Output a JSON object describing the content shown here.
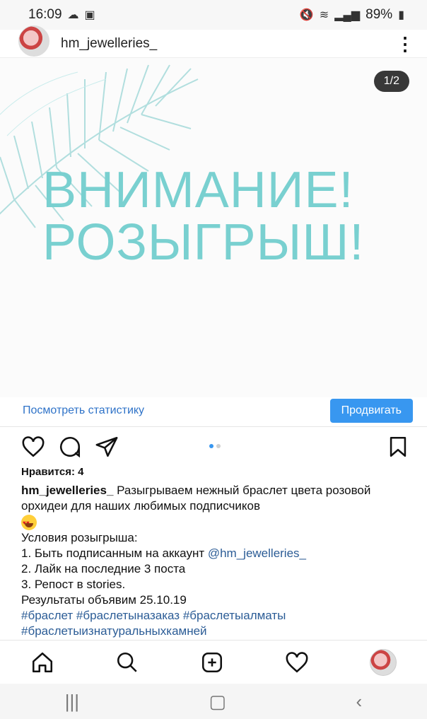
{
  "status": {
    "time": "16:09",
    "battery": "89%"
  },
  "post": {
    "username": "hm_jewelleries_",
    "counter": "1/2",
    "headline_line1": "ВНИМАНИЕ!",
    "headline_line2": "РОЗЫГРЫШ!"
  },
  "promo": {
    "stats_link": "Посмотреть статистику",
    "promote_button": "Продвигать"
  },
  "engagement": {
    "likes": "Нравится: 4"
  },
  "caption": {
    "username": "hm_jewelleries_",
    "line1": "Разыгрываем нежный браслет цвета розовой орхидеи для наших любимых подписчиков",
    "conditions_title": "Условия розыгрыша:",
    "condition1_text": "1. Быть подписанным на аккаунт ",
    "condition1_link": "@hm_jewelleries_",
    "condition2": "2. Лайк на последние 3 поста",
    "condition3": "3. Репост в stories.",
    "results": "Результаты объявим 25.10.19",
    "hashtags1": "#браслет #браслетыназаказ #браслетыалматы",
    "hashtags2": "#браслетыизнатуральныхкамней"
  },
  "icons": {
    "status": [
      "cloud-icon",
      "gallery-icon",
      "mute-icon",
      "wifi-icon",
      "signal-icon",
      "battery-icon"
    ],
    "actions": [
      "heart-icon",
      "comment-icon",
      "share-icon",
      "bookmark-icon"
    ],
    "nav": [
      "home-icon",
      "search-icon",
      "add-post-icon",
      "activity-heart-icon",
      "profile-avatar"
    ],
    "system_nav": [
      "recent-apps-icon",
      "home-button-icon",
      "back-icon"
    ]
  },
  "colors": {
    "headline": "#79d0d0",
    "primary": "#3897f0",
    "link": "#2b5c96"
  }
}
